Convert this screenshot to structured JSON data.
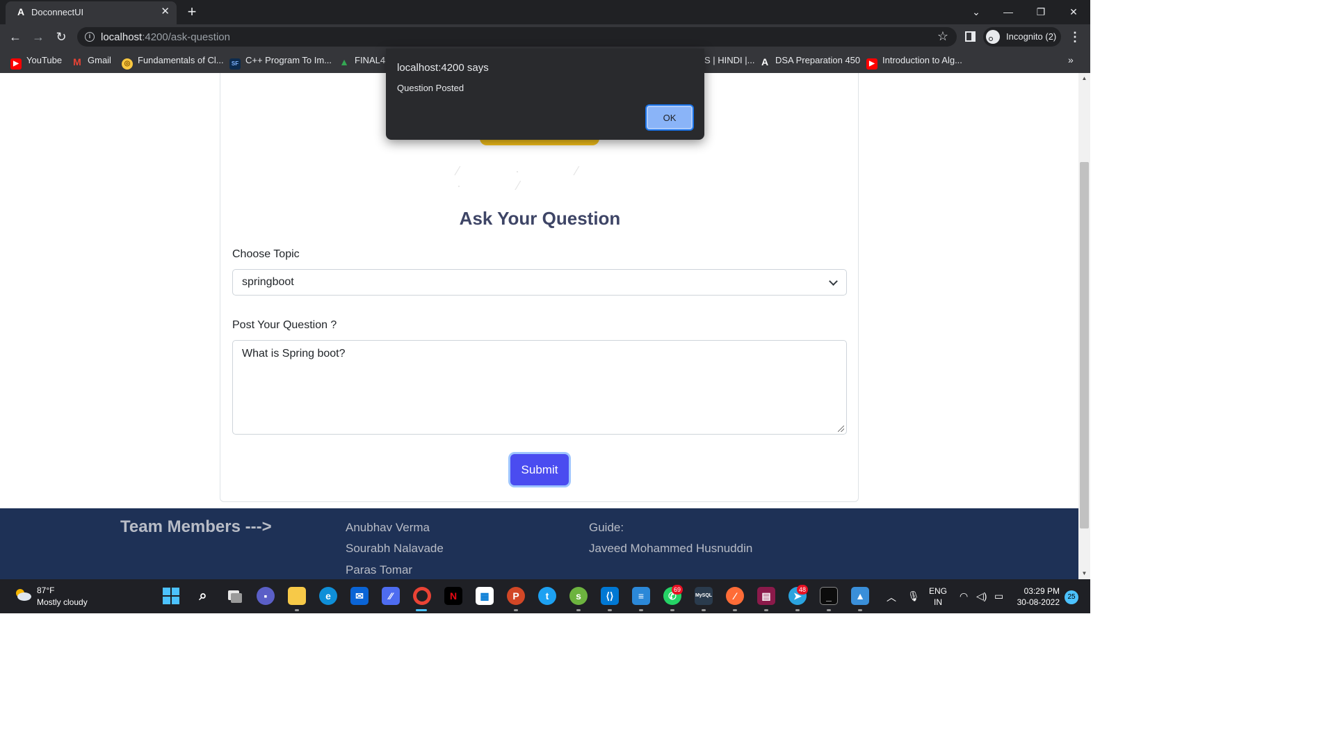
{
  "browser": {
    "tab_title": "DoconnectUI",
    "tab_favicon": "A",
    "url_host": "localhost",
    "url_path": ":4200/ask-question",
    "incognito_label": "Incognito (2)"
  },
  "bookmarks": [
    {
      "label": "YouTube",
      "icon": "youtube-icon"
    },
    {
      "label": "Gmail",
      "icon": "gmail-icon"
    },
    {
      "label": "Fundamentals of Cl...",
      "icon": "coin-icon"
    },
    {
      "label": "C++ Program To Im...",
      "icon": "gfg-icon"
    },
    {
      "label": "FINAL45",
      "icon": "google-drive-icon"
    },
    {
      "label": "S | HINDI |...",
      "icon": ""
    },
    {
      "label": "DSA Preparation 450",
      "icon": "angular-icon"
    },
    {
      "label": "Introduction to Alg...",
      "icon": "youtube-icon"
    }
  ],
  "dialog": {
    "title": "localhost:4200 says",
    "message": "Question Posted",
    "ok_label": "OK"
  },
  "form": {
    "heading": "Ask Your Question",
    "topic_label": "Choose Topic",
    "topic_value": "springboot",
    "question_label": "Post Your Question ?",
    "question_value": "What is Spring boot?",
    "submit_label": "Submit"
  },
  "footer": {
    "title": "Team Members --->",
    "members": [
      "Anubhav Verma",
      "Sourabh Nalavade",
      "Paras Tomar"
    ],
    "guide_label": "Guide:",
    "guide_name": "Javeed Mohammed Husnuddin"
  },
  "taskbar": {
    "weather_temp": "87°F",
    "weather_desc": "Mostly cloudy",
    "whatsapp_badge": "69",
    "telegram_badge": "48",
    "lang_top": "ENG",
    "lang_bottom": "IN",
    "time": "03:29 PM",
    "date": "30-08-2022",
    "notifications": "25"
  },
  "colors": {
    "accent": "#4a4cf0",
    "footer_bg": "#1e3156",
    "banner": "#f6c21a",
    "dialog_ok": "#8ab4f8"
  }
}
